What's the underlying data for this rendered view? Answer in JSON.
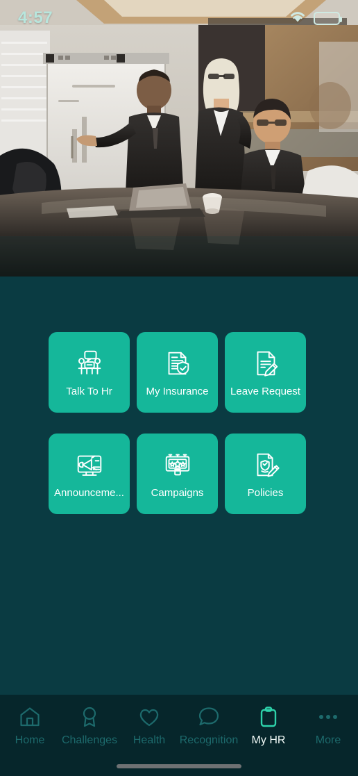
{
  "status_bar": {
    "time": "4:57",
    "wifi_icon": "wifi-icon",
    "battery_icon": "battery-icon"
  },
  "hero": {
    "image_description": "Business meeting in a conference room: a presenter in a dark suit gestures at a flipchart while colleagues sit around a glossy dark table",
    "name": "hero-banner-image"
  },
  "colors": {
    "background": "#0a3b42",
    "tile": "#15b79a",
    "tabbar": "#06262b",
    "tab_active": "#2ed3ab",
    "tab_inactive": "#1d6a6c",
    "status_text": "#b8e6dd"
  },
  "tiles": [
    {
      "label": "Talk To Hr",
      "icon": "talk-to-hr-icon"
    },
    {
      "label": "My Insurance",
      "icon": "insurance-document-shield-icon"
    },
    {
      "label": "Leave Request",
      "icon": "document-pencil-icon"
    },
    {
      "label": "Announceme...",
      "icon": "megaphone-screen-icon"
    },
    {
      "label": "Campaigns",
      "icon": "billboard-stars-icon"
    },
    {
      "label": "Policies",
      "icon": "policy-shield-pencil-icon"
    }
  ],
  "tabs": [
    {
      "label": "Home",
      "icon": "home-icon",
      "active": false
    },
    {
      "label": "Challenges",
      "icon": "award-ribbon-icon",
      "active": false
    },
    {
      "label": "Health",
      "icon": "heart-icon",
      "active": false
    },
    {
      "label": "Recognition",
      "icon": "chat-bubble-icon",
      "active": false
    },
    {
      "label": "My HR",
      "icon": "clipboard-icon",
      "active": true
    },
    {
      "label": "More",
      "icon": "ellipsis-icon",
      "active": false
    }
  ]
}
